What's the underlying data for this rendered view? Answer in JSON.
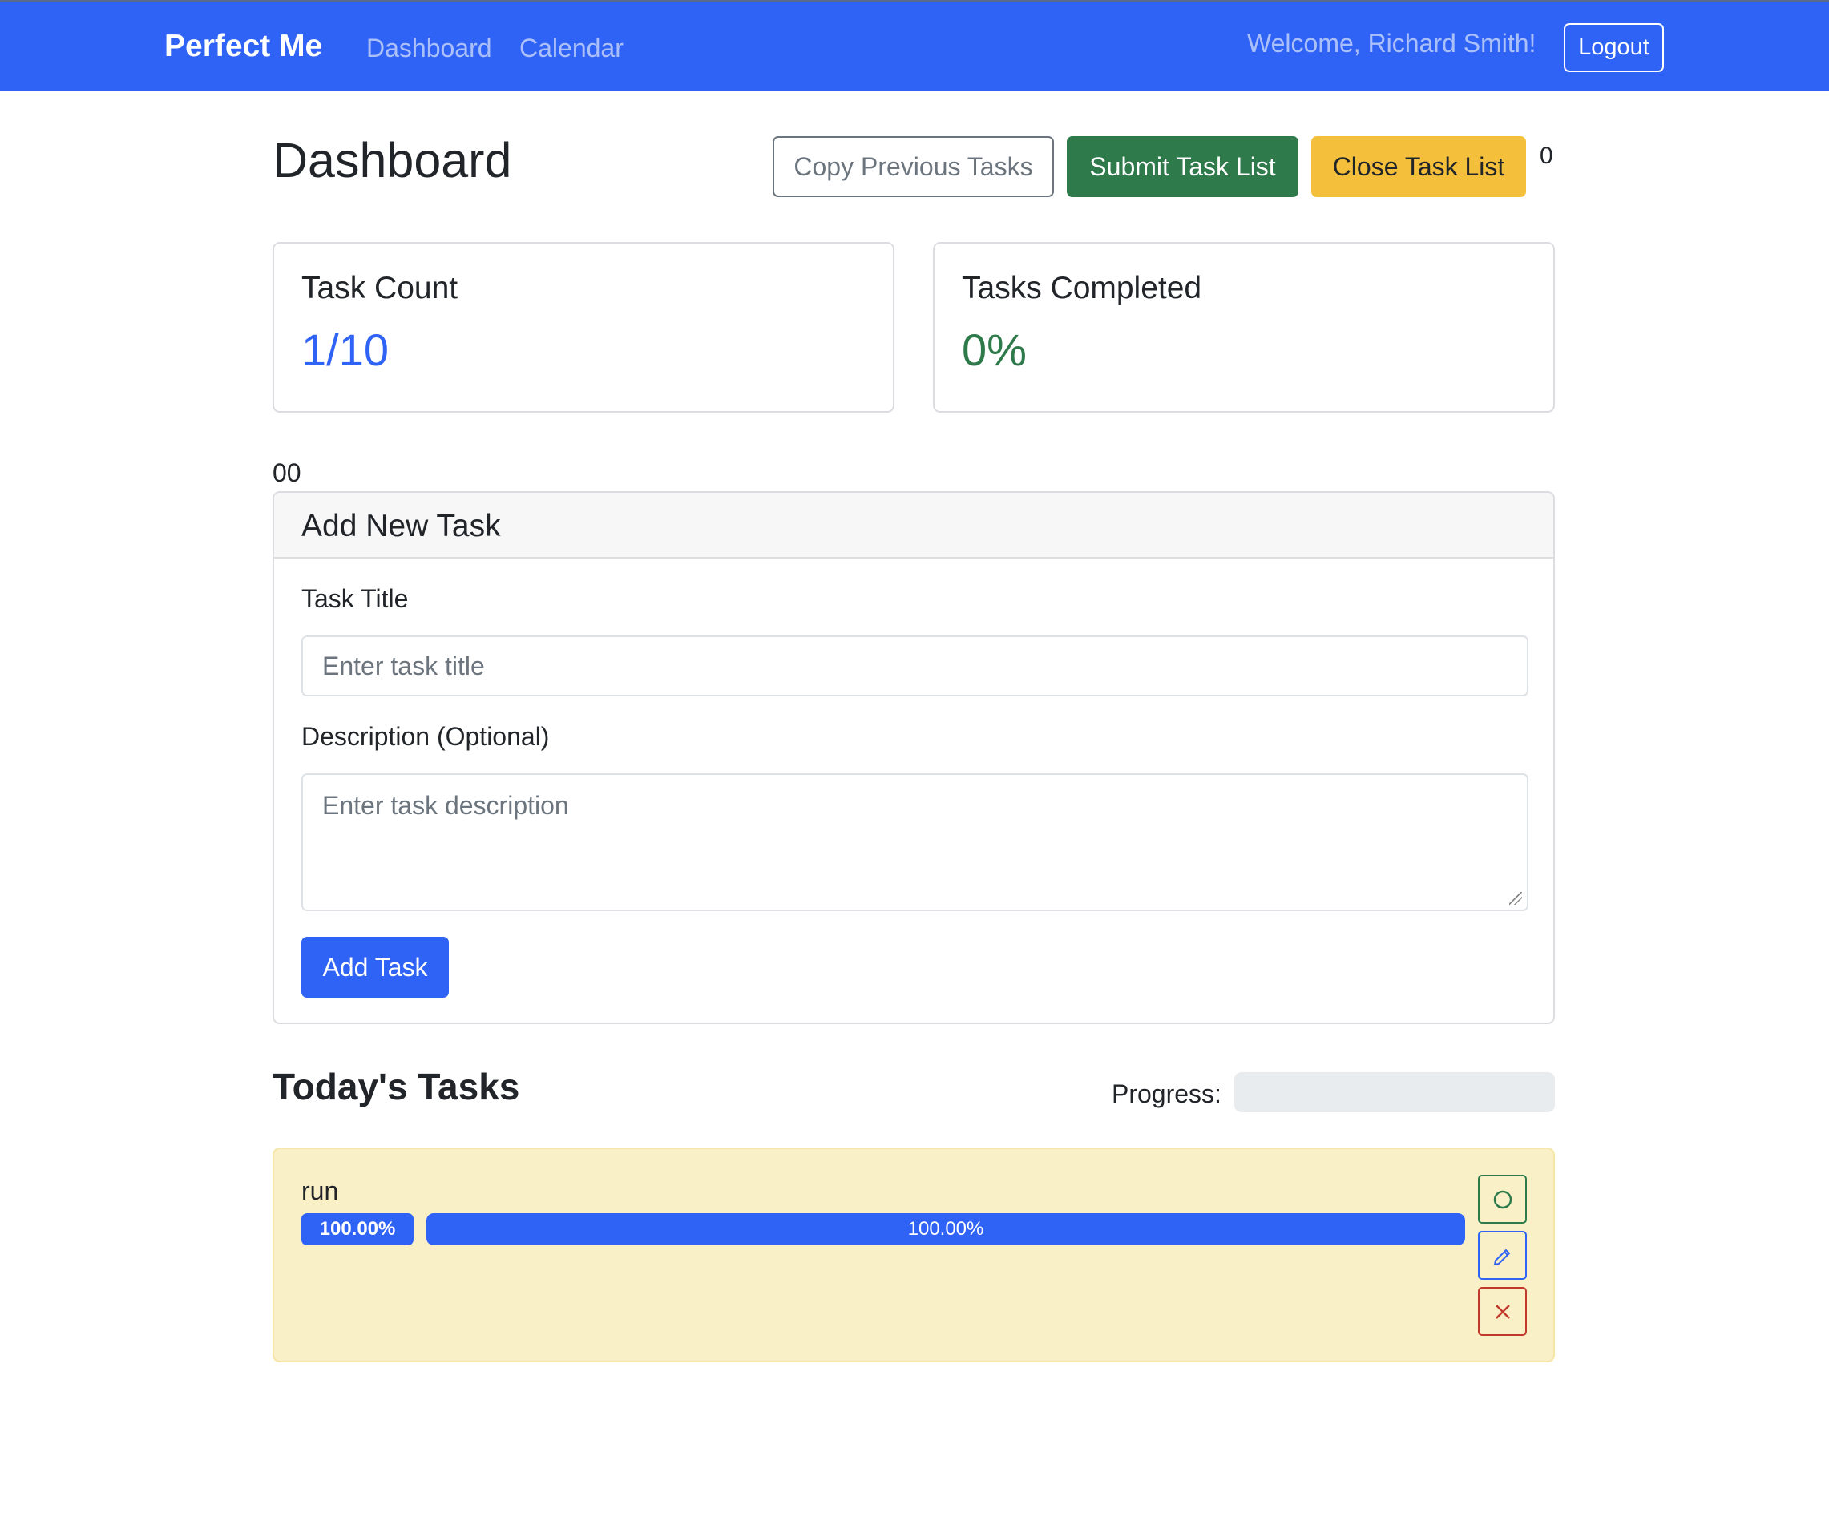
{
  "navbar": {
    "brand": "Perfect Me",
    "links": [
      "Dashboard",
      "Calendar"
    ],
    "welcome": "Welcome, Richard Smith!",
    "logout_label": "Logout"
  },
  "header": {
    "title": "Dashboard",
    "copy_label": "Copy Previous Tasks",
    "submit_label": "Submit Task List",
    "close_label": "Close Task List",
    "counter": "0"
  },
  "stats": {
    "task_count_label": "Task Count",
    "task_count_value": "1/10",
    "completed_label": "Tasks Completed",
    "completed_value": "0%"
  },
  "zeros_text": "00",
  "add_task": {
    "header": "Add New Task",
    "title_label": "Task Title",
    "title_placeholder": "Enter task title",
    "desc_label": "Description (Optional)",
    "desc_placeholder": "Enter task description",
    "button_label": "Add Task"
  },
  "today": {
    "title": "Today's Tasks",
    "progress_label": "Progress:",
    "progress_value": 0,
    "tasks": [
      {
        "name": "run",
        "badge": "100.00%",
        "bar_text": "100.00%",
        "progress": 1.0
      }
    ]
  },
  "colors": {
    "primary": "#2f63f5",
    "success": "#2f7a4a",
    "warning": "#f4bf3a",
    "danger": "#c0392b",
    "task_bg": "#faf0c8"
  },
  "icons": {
    "complete": "circle-icon",
    "edit": "pencil-icon",
    "delete": "x-icon"
  }
}
